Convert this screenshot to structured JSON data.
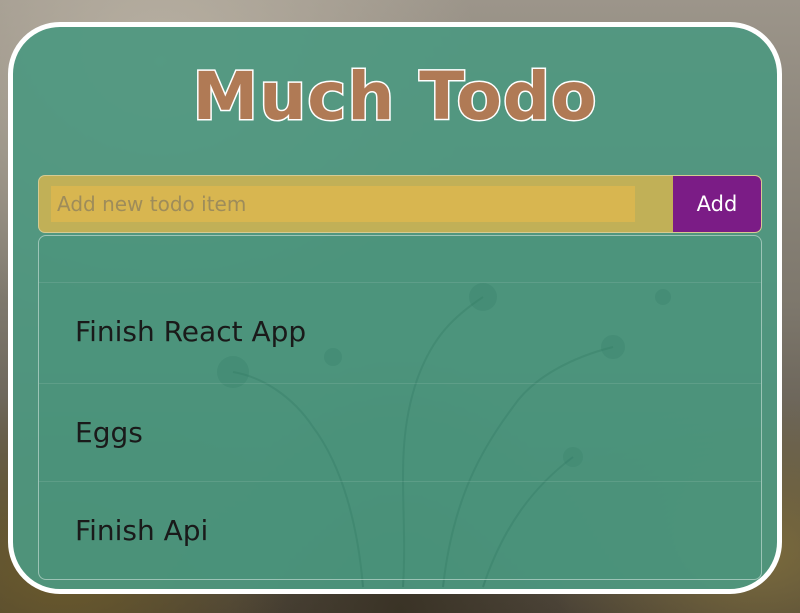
{
  "app": {
    "title": "Much Todo"
  },
  "add_form": {
    "input_value": "",
    "input_placeholder": "Add new todo item",
    "add_label": "Add"
  },
  "todos": [
    {
      "label": "Finish React App"
    },
    {
      "label": "Eggs"
    },
    {
      "label": "Finish Api"
    }
  ],
  "colors": {
    "card": "#4e9880",
    "title_fill": "#b07a55",
    "title_stroke": "#ffffff",
    "input_bg": "#d8b650",
    "add_button": "#7b1c86",
    "card_border": "#ffffff"
  }
}
